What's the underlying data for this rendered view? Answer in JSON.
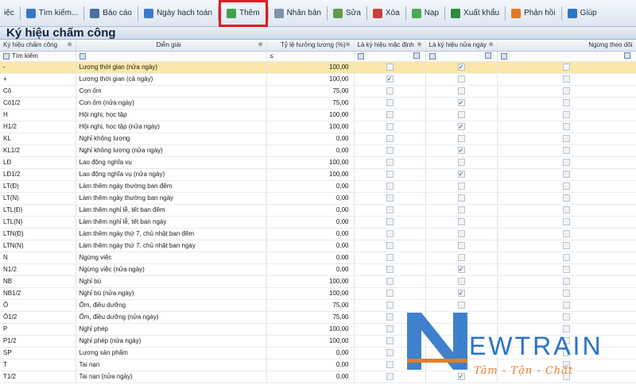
{
  "toolbar": [
    {
      "name": "tool-view-button",
      "label": "iệc",
      "icon": "none-icon",
      "color": "#2b5fa8"
    },
    {
      "name": "tool-search-button",
      "label": "Tìm kiếm...",
      "icon": "magnifier-icon",
      "color": "#3a78c4"
    },
    {
      "name": "tool-report-button",
      "label": "Báo cáo",
      "icon": "report-icon",
      "color": "#4a6fa0"
    },
    {
      "name": "tool-accounting-date-button",
      "label": "Ngày hạch toán",
      "icon": "calendar-icon",
      "color": "#3d7bc9"
    },
    {
      "name": "tool-add-button",
      "label": "Thêm",
      "icon": "add-icon",
      "color": "#3fa24a",
      "highlight": true
    },
    {
      "name": "tool-duplicate-button",
      "label": "Nhân bản",
      "icon": "copy-icon",
      "color": "#7f93ab"
    },
    {
      "name": "tool-edit-button",
      "label": "Sửa",
      "icon": "edit-icon",
      "color": "#5f9d4d"
    },
    {
      "name": "tool-delete-button",
      "label": "Xóa",
      "icon": "delete-icon",
      "color": "#c9413a"
    },
    {
      "name": "tool-reload-button",
      "label": "Nạp",
      "icon": "refresh-icon",
      "color": "#4caa55"
    },
    {
      "name": "tool-export-button",
      "label": "Xuất khẩu",
      "icon": "excel-icon",
      "color": "#2f8a3d"
    },
    {
      "name": "tool-feedback-button",
      "label": "Phản hồi",
      "icon": "chat-icon",
      "color": "#e07a26"
    },
    {
      "name": "tool-help-button",
      "label": "Giúp",
      "icon": "help-icon",
      "color": "#2f76c7"
    }
  ],
  "title": "Ký hiệu chấm công",
  "columns": {
    "code": "Ký hiệu chấm công",
    "desc": "Diễn giải",
    "rate": "Tỷ lệ hưởng lương (%)",
    "default": "Là ký hiệu mặc định",
    "half": "Là ký hiệu nửa ngày",
    "stop": "Ngừng theo dõi"
  },
  "filter": {
    "search_label": "Tìm kiếm",
    "rate_operator": "≤"
  },
  "rows": [
    {
      "code": "-",
      "desc": "Lương thời gian (nửa ngày)",
      "rate": "100,00",
      "default": false,
      "half": true,
      "selected": true
    },
    {
      "code": "+",
      "desc": "Lương thời gian (cả ngày)",
      "rate": "100,00",
      "default": true,
      "half": false
    },
    {
      "code": "Cô",
      "desc": "Con ốm",
      "rate": "75,00",
      "default": false,
      "half": false
    },
    {
      "code": "Cô1/2",
      "desc": "Con ốm (nửa ngày)",
      "rate": "75,00",
      "default": false,
      "half": true
    },
    {
      "code": "H",
      "desc": "Hội nghị, học tập",
      "rate": "100,00",
      "default": false,
      "half": false
    },
    {
      "code": "H1/2",
      "desc": "Hội nghị, học tập (nửa ngày)",
      "rate": "100,00",
      "default": false,
      "half": true
    },
    {
      "code": "KL",
      "desc": "Nghỉ không lương",
      "rate": "0,00",
      "default": false,
      "half": false
    },
    {
      "code": "KL1/2",
      "desc": "Nghỉ không lương (nửa ngày)",
      "rate": "0,00",
      "default": false,
      "half": true
    },
    {
      "code": "LĐ",
      "desc": "Lao động nghĩa vụ",
      "rate": "100,00",
      "default": false,
      "half": false
    },
    {
      "code": "LĐ1/2",
      "desc": "Lao động nghĩa vụ (nửa ngày)",
      "rate": "100,00",
      "default": false,
      "half": true
    },
    {
      "code": "LT(Đ)",
      "desc": "Làm thêm ngày thường ban đêm",
      "rate": "0,00",
      "default": false,
      "half": false
    },
    {
      "code": "LT(N)",
      "desc": "Làm thêm ngày thường ban ngày",
      "rate": "0,00",
      "default": false,
      "half": false
    },
    {
      "code": "LTL(Đ)",
      "desc": "Làm thêm nghỉ lễ, tết ban đêm",
      "rate": "0,00",
      "default": false,
      "half": false
    },
    {
      "code": "LTL(N)",
      "desc": "Làm thêm nghỉ lễ, tết ban ngày",
      "rate": "0,00",
      "default": false,
      "half": false
    },
    {
      "code": "LTN(Đ)",
      "desc": "Làm thêm ngày thứ 7, chủ nhật ban đêm",
      "rate": "0,00",
      "default": false,
      "half": false
    },
    {
      "code": "LTN(N)",
      "desc": "Làm thêm ngày thứ 7, chủ nhật ban ngày",
      "rate": "0,00",
      "default": false,
      "half": false
    },
    {
      "code": "N",
      "desc": "Ngừng việc",
      "rate": "0,00",
      "default": false,
      "half": false
    },
    {
      "code": "N1/2",
      "desc": "Ngừng việc (nửa ngày)",
      "rate": "0,00",
      "default": false,
      "half": true
    },
    {
      "code": "NB",
      "desc": "Nghỉ bù",
      "rate": "100,00",
      "default": false,
      "half": false
    },
    {
      "code": "NB1/2",
      "desc": "Nghỉ bù (nửa ngày)",
      "rate": "100,00",
      "default": false,
      "half": true
    },
    {
      "code": "Ô",
      "desc": "Ốm, điều dưỡng",
      "rate": "75,00",
      "default": false,
      "half": false
    },
    {
      "code": "Ô1/2",
      "desc": "Ốm, điều dưỡng (nửa ngày)",
      "rate": "75,00",
      "default": false,
      "half": true
    },
    {
      "code": "P",
      "desc": "Nghỉ phép",
      "rate": "100,00",
      "default": false,
      "half": false
    },
    {
      "code": "P1/2",
      "desc": "Nghỉ phép (nửa ngày)",
      "rate": "100,00",
      "default": false,
      "half": true
    },
    {
      "code": "SP",
      "desc": "Lương sản phẩm",
      "rate": "0,00",
      "default": false,
      "half": false
    },
    {
      "code": "T",
      "desc": "Tai nạn",
      "rate": "0,00",
      "default": false,
      "half": false
    },
    {
      "code": "T1/2",
      "desc": "Tai nạn (nửa ngày)",
      "rate": "0,00",
      "default": false,
      "half": true
    }
  ],
  "watermark": {
    "brand": "EWTRAIN",
    "tagline": "Tâm - Tận - Chất",
    "colors": {
      "blue": "#2a73c6",
      "orange": "#e67e22"
    }
  }
}
